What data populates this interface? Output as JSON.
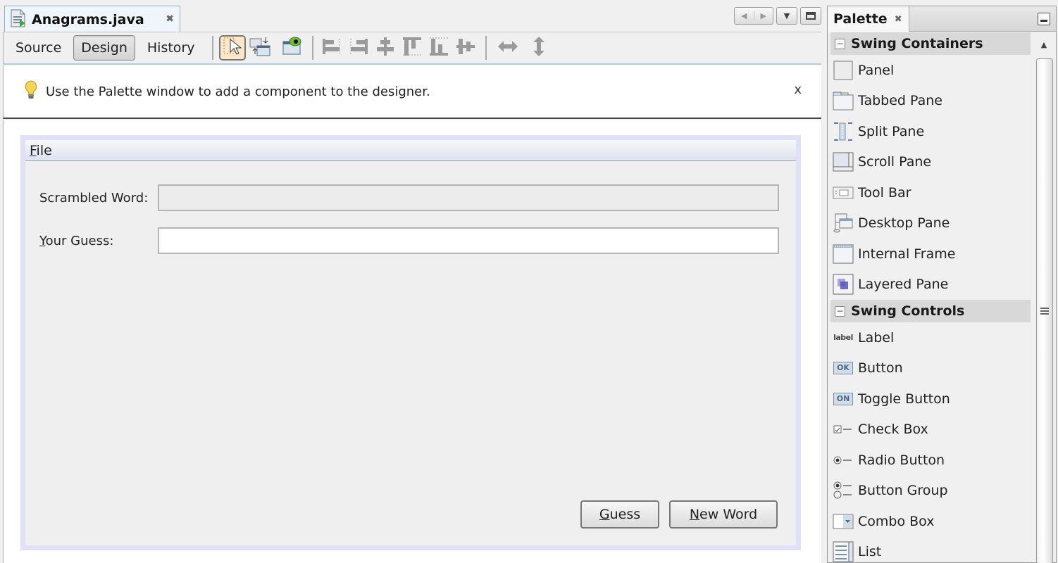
{
  "editor": {
    "tab": {
      "title": "Anagrams.java",
      "icon": "java-file-icon",
      "close_icon": "close-icon"
    },
    "window_controls": [
      {
        "name": "scroll-tabs-left",
        "icon": "left-arrow-icon"
      },
      {
        "name": "scroll-tabs-right",
        "icon": "right-arrow-icon"
      },
      {
        "name": "show-documents-list",
        "icon": "dropdown-icon"
      },
      {
        "name": "maximize-window",
        "icon": "maximize-icon"
      }
    ],
    "toolbar": {
      "view_tabs": [
        {
          "label": "Source",
          "active": false
        },
        {
          "label": "Design",
          "active": true
        },
        {
          "label": "History",
          "active": false
        }
      ],
      "tools": [
        {
          "name": "selection-mode",
          "icon": "cursor-select-icon",
          "selected": true
        },
        {
          "name": "connection-mode",
          "icon": "connection-mode-icon"
        },
        {
          "name": "preview-design",
          "icon": "eye-preview-icon"
        },
        {
          "name": "align-left",
          "icon": "align-left-icon"
        },
        {
          "name": "align-right",
          "icon": "align-right-icon"
        },
        {
          "name": "center-horizontally",
          "icon": "center-horizontal-icon"
        },
        {
          "name": "align-top",
          "icon": "align-top-icon"
        },
        {
          "name": "align-bottom",
          "icon": "align-bottom-icon"
        },
        {
          "name": "center-vertically",
          "icon": "center-vertical-icon"
        },
        {
          "name": "change-horizontal-resizability",
          "icon": "horizontal-resize-icon"
        },
        {
          "name": "change-vertical-resizability",
          "icon": "vertical-resize-icon"
        }
      ]
    },
    "hint": {
      "icon": "lightbulb-icon",
      "text": "Use the Palette window to add a component to the designer.",
      "close": "x"
    },
    "form": {
      "menu": {
        "label": "File",
        "mnemonic": "F"
      },
      "scrambled_label": "Scrambled Word:",
      "scrambled_value": "",
      "guess_label_mnemonic": "Y",
      "guess_label_rest": "our Guess:",
      "guess_value": "",
      "buttons": [
        {
          "mnemonic": "G",
          "rest": "uess"
        },
        {
          "mnemonic": "N",
          "rest": "ew Word"
        }
      ]
    }
  },
  "palette": {
    "title": "Palette",
    "categories": [
      {
        "label": "Swing Containers",
        "collapse_symbol": "−",
        "items": [
          {
            "label": "Panel",
            "icon": "panel-icon"
          },
          {
            "label": "Tabbed Pane",
            "icon": "tabbed-pane-icon"
          },
          {
            "label": "Split Pane",
            "icon": "split-pane-icon"
          },
          {
            "label": "Scroll Pane",
            "icon": "scroll-pane-icon"
          },
          {
            "label": "Tool Bar",
            "icon": "tool-bar-icon"
          },
          {
            "label": "Desktop Pane",
            "icon": "desktop-pane-icon"
          },
          {
            "label": "Internal Frame",
            "icon": "internal-frame-icon"
          },
          {
            "label": "Layered Pane",
            "icon": "layered-pane-icon"
          }
        ]
      },
      {
        "label": "Swing Controls",
        "collapse_symbol": "−",
        "items": [
          {
            "label": "Label",
            "icon": "label-icon",
            "icon_text": "label"
          },
          {
            "label": "Button",
            "icon": "button-icon",
            "icon_text": "OK"
          },
          {
            "label": "Toggle Button",
            "icon": "toggle-button-icon",
            "icon_text": "ON"
          },
          {
            "label": "Check Box",
            "icon": "check-box-icon"
          },
          {
            "label": "Radio Button",
            "icon": "radio-button-icon"
          },
          {
            "label": "Button Group",
            "icon": "button-group-icon"
          },
          {
            "label": "Combo Box",
            "icon": "combo-box-icon"
          },
          {
            "label": "List",
            "icon": "list-icon"
          }
        ]
      }
    ]
  }
}
